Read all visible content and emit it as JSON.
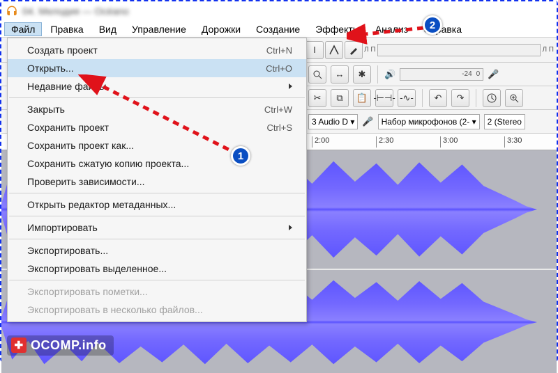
{
  "title": "04. Мелодия — Océano",
  "menubar": [
    "Файл",
    "Правка",
    "Вид",
    "Управление",
    "Дорожки",
    "Создание",
    "Эффекты",
    "Анализ",
    "Справка"
  ],
  "menubar_open_index": 0,
  "dropdown": {
    "items": [
      {
        "label": "Создать проект",
        "shortcut": "Ctrl+N",
        "type": "item"
      },
      {
        "label": "Открыть...",
        "shortcut": "Ctrl+O",
        "type": "item",
        "highlight": true
      },
      {
        "label": "Недавние файлы",
        "type": "submenu"
      },
      {
        "type": "sep"
      },
      {
        "label": "Закрыть",
        "shortcut": "Ctrl+W",
        "type": "item"
      },
      {
        "label": "Сохранить проект",
        "shortcut": "Ctrl+S",
        "type": "item"
      },
      {
        "label": "Сохранить проект как...",
        "type": "item"
      },
      {
        "label": "Сохранить сжатую копию проекта...",
        "type": "item"
      },
      {
        "label": "Проверить зависимости...",
        "type": "item"
      },
      {
        "type": "sep"
      },
      {
        "label": "Открыть редактор метаданных...",
        "type": "item"
      },
      {
        "type": "sep"
      },
      {
        "label": "Импортировать",
        "type": "submenu"
      },
      {
        "type": "sep"
      },
      {
        "label": "Экспортировать...",
        "type": "item"
      },
      {
        "label": "Экспортировать выделенное...",
        "type": "item"
      },
      {
        "type": "sep"
      },
      {
        "label": "Экспортировать пометки...",
        "type": "item",
        "disabled": true
      },
      {
        "label": "Экспортировать в несколько файлов...",
        "type": "item",
        "disabled": true
      }
    ]
  },
  "meter": {
    "level": "-24",
    "zero": "0"
  },
  "meter_labels": {
    "lp_left": "Л П",
    "lp_right": "Л П"
  },
  "device_row": {
    "host": "3 Audio D",
    "input": "Набор микрофонов (2-",
    "channels": "2 (Stereo"
  },
  "timeline": {
    "ticks": [
      "2:00",
      "2:30",
      "3:00",
      "3:30"
    ]
  },
  "annotations": {
    "badge1": "1",
    "badge2": "2"
  },
  "watermark": "OCOMP.info"
}
